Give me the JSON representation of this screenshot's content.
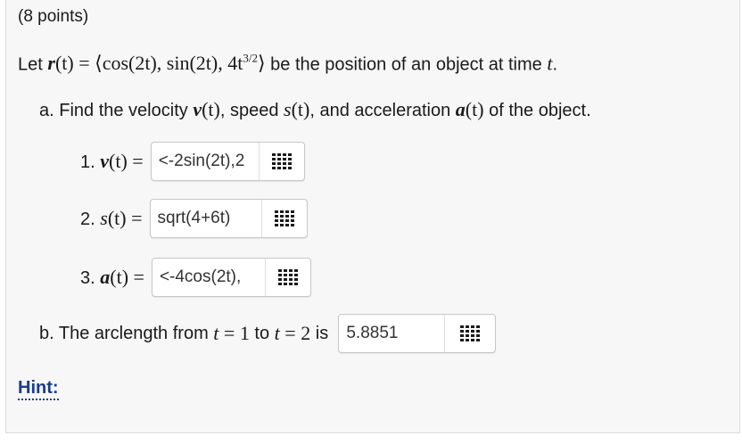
{
  "points": "(8 points)",
  "problem": {
    "let": "Let",
    "r": "r",
    "t_paren": "(t)",
    "eq": "=",
    "vector": "⟨cos(2t), sin(2t), 4t",
    "exp": "3/2",
    "close": "⟩",
    "rest": "be the position of an object at time",
    "t": "t",
    "period": "."
  },
  "part_a": {
    "prefix": "a. Find the velocity",
    "v": "v",
    "t1": "(t)",
    "speed": ", speed",
    "s": "s",
    "t2": "(t)",
    "and_acc": ", and acceleration",
    "a": "a",
    "t3": "(t)",
    "suffix": "of the object."
  },
  "answers": [
    {
      "num": "1.",
      "sym": "v",
      "tpar": "(t)",
      "eq": "=",
      "value": "<-2sin(2t),2"
    },
    {
      "num": "2.",
      "sym": "s",
      "tpar": "(t)",
      "eq": "=",
      "value": "sqrt(4+6t)"
    },
    {
      "num": "3.",
      "sym": "a",
      "tpar": "(t)",
      "eq": "=",
      "value": "<-4cos(2t),"
    }
  ],
  "part_b": {
    "text1": "b. The arclength from",
    "t": "t",
    "eq1": "= 1",
    "to": "to",
    "t2": "t",
    "eq2": "= 2",
    "is": "is",
    "value": "5.8851"
  },
  "hint": "Hint:",
  "icons": {
    "matrix": "equation-editor-grid-icon"
  }
}
